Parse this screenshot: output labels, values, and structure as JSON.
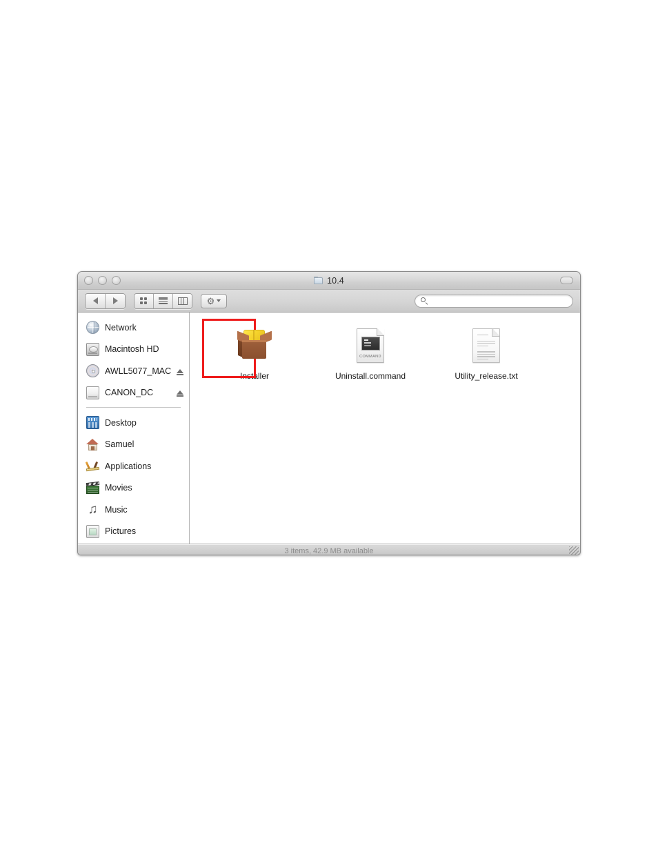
{
  "window": {
    "title": "10.4",
    "title_icon": "folder-icon",
    "traffic_lights": [
      "close-button",
      "minimize-button",
      "zoom-button"
    ],
    "toolbar_toggle": "toolbar-toggle-button"
  },
  "toolbar": {
    "back_label": "Back",
    "forward_label": "Forward",
    "view_icon_label": "Icon View",
    "view_list_label": "List View",
    "view_column_label": "Column View",
    "action_label": "Action",
    "action_glyph": "⚙"
  },
  "search": {
    "value": "",
    "placeholder": "",
    "icon": "search-icon"
  },
  "sidebar": {
    "devices": [
      {
        "label": "Network",
        "icon": "network-globe-icon",
        "eject": false
      },
      {
        "label": "Macintosh HD",
        "icon": "hard-disk-icon",
        "eject": false
      },
      {
        "label": "AWLL5077_MAC",
        "icon": "optical-disc-icon",
        "eject": true
      },
      {
        "label": "CANON_DC",
        "icon": "external-drive-icon",
        "eject": true
      }
    ],
    "places": [
      {
        "label": "Desktop",
        "icon": "desktop-icon"
      },
      {
        "label": "Samuel",
        "icon": "home-icon"
      },
      {
        "label": "Applications",
        "icon": "applications-icon"
      },
      {
        "label": "Movies",
        "icon": "movies-clapper-icon"
      },
      {
        "label": "Music",
        "icon": "music-note-icon",
        "glyph": "♫"
      },
      {
        "label": "Pictures",
        "icon": "pictures-frame-icon"
      }
    ]
  },
  "content": {
    "files": [
      {
        "label": "Installer",
        "icon": "package-box-icon",
        "highlighted": true
      },
      {
        "label": "Uninstall.command",
        "icon": "command-script-icon",
        "badge": "COMMAND",
        "highlighted": false
      },
      {
        "label": "Utility_release.txt",
        "icon": "text-document-icon",
        "highlighted": false
      }
    ]
  },
  "statusbar": {
    "text": "3 items, 42.9 MB available"
  },
  "colors": {
    "highlight": "#ee1c1c",
    "window_chrome": "#d4d4d4",
    "content_background": "#ffffff",
    "status_text": "#8c8c8c"
  }
}
